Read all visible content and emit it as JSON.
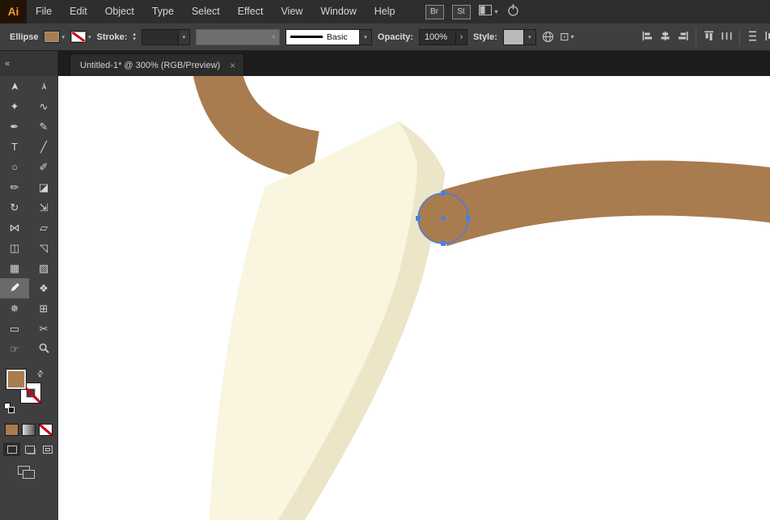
{
  "app": {
    "logo_text": "Ai"
  },
  "menubar": {
    "items": [
      "File",
      "Edit",
      "Object",
      "Type",
      "Select",
      "Effect",
      "View",
      "Window",
      "Help"
    ],
    "bridge_label": "Br",
    "stock_label": "St"
  },
  "controlbar": {
    "tool_name": "Ellipse",
    "stroke_label": "Stroke:",
    "stroke_weight_value": "",
    "brush_name": "Basic",
    "opacity_label": "Opacity:",
    "opacity_value": "100%",
    "panel_arrow_glyph": "›",
    "style_label": "Style:",
    "transform_glyph": "⊡"
  },
  "tabbar": {
    "collapse_glyph": "«",
    "title": "Untitled-1* @ 300% (RGB/Preview)",
    "close_glyph": "×"
  },
  "toolbar": {
    "selected_tool": "eyedropper-tool",
    "tools": [
      {
        "name": "selection-tool",
        "glyph": "➤"
      },
      {
        "name": "direct-selection-tool",
        "glyph": "➢"
      },
      {
        "name": "magic-wand-tool",
        "glyph": "✦"
      },
      {
        "name": "lasso-tool",
        "glyph": "∿"
      },
      {
        "name": "pen-tool",
        "glyph": "✒"
      },
      {
        "name": "curvature-tool",
        "glyph": "✎"
      },
      {
        "name": "type-tool",
        "glyph": "T"
      },
      {
        "name": "line-segment-tool",
        "glyph": "╱"
      },
      {
        "name": "ellipse-tool",
        "glyph": "○"
      },
      {
        "name": "paintbrush-tool",
        "glyph": "✐"
      },
      {
        "name": "shaper-tool",
        "glyph": "✏"
      },
      {
        "name": "eraser-tool",
        "glyph": "◪"
      },
      {
        "name": "rotate-tool",
        "glyph": "↻"
      },
      {
        "name": "scale-tool",
        "glyph": "⇲"
      },
      {
        "name": "width-tool",
        "glyph": "⋈"
      },
      {
        "name": "free-transform-tool",
        "glyph": "▱"
      },
      {
        "name": "shape-builder-tool",
        "glyph": "◫"
      },
      {
        "name": "perspective-grid-tool",
        "glyph": "◹"
      },
      {
        "name": "mesh-tool",
        "glyph": "▦"
      },
      {
        "name": "gradient-tool",
        "glyph": "▧"
      },
      {
        "name": "eyedropper-tool"
      },
      {
        "name": "blend-tool",
        "glyph": "❖"
      },
      {
        "name": "symbol-sprayer-tool",
        "glyph": "✵"
      },
      {
        "name": "graph-tool",
        "glyph": "⊞"
      },
      {
        "name": "artboard-tool",
        "glyph": "▭"
      },
      {
        "name": "slice-tool",
        "glyph": "✂"
      },
      {
        "name": "hand-tool",
        "glyph": "☞"
      },
      {
        "name": "zoom-tool"
      }
    ],
    "swap_glyph": "⇄"
  },
  "swatches": {
    "fill_color": "#a87c4e",
    "stroke": "none"
  },
  "artwork": {
    "canvas_bg": "#ffffff",
    "brown": "#a87c4e",
    "cream_light": "#f9f5de",
    "cream_shadow": "#ece5c7",
    "selection_blue": "#4a7de2"
  }
}
